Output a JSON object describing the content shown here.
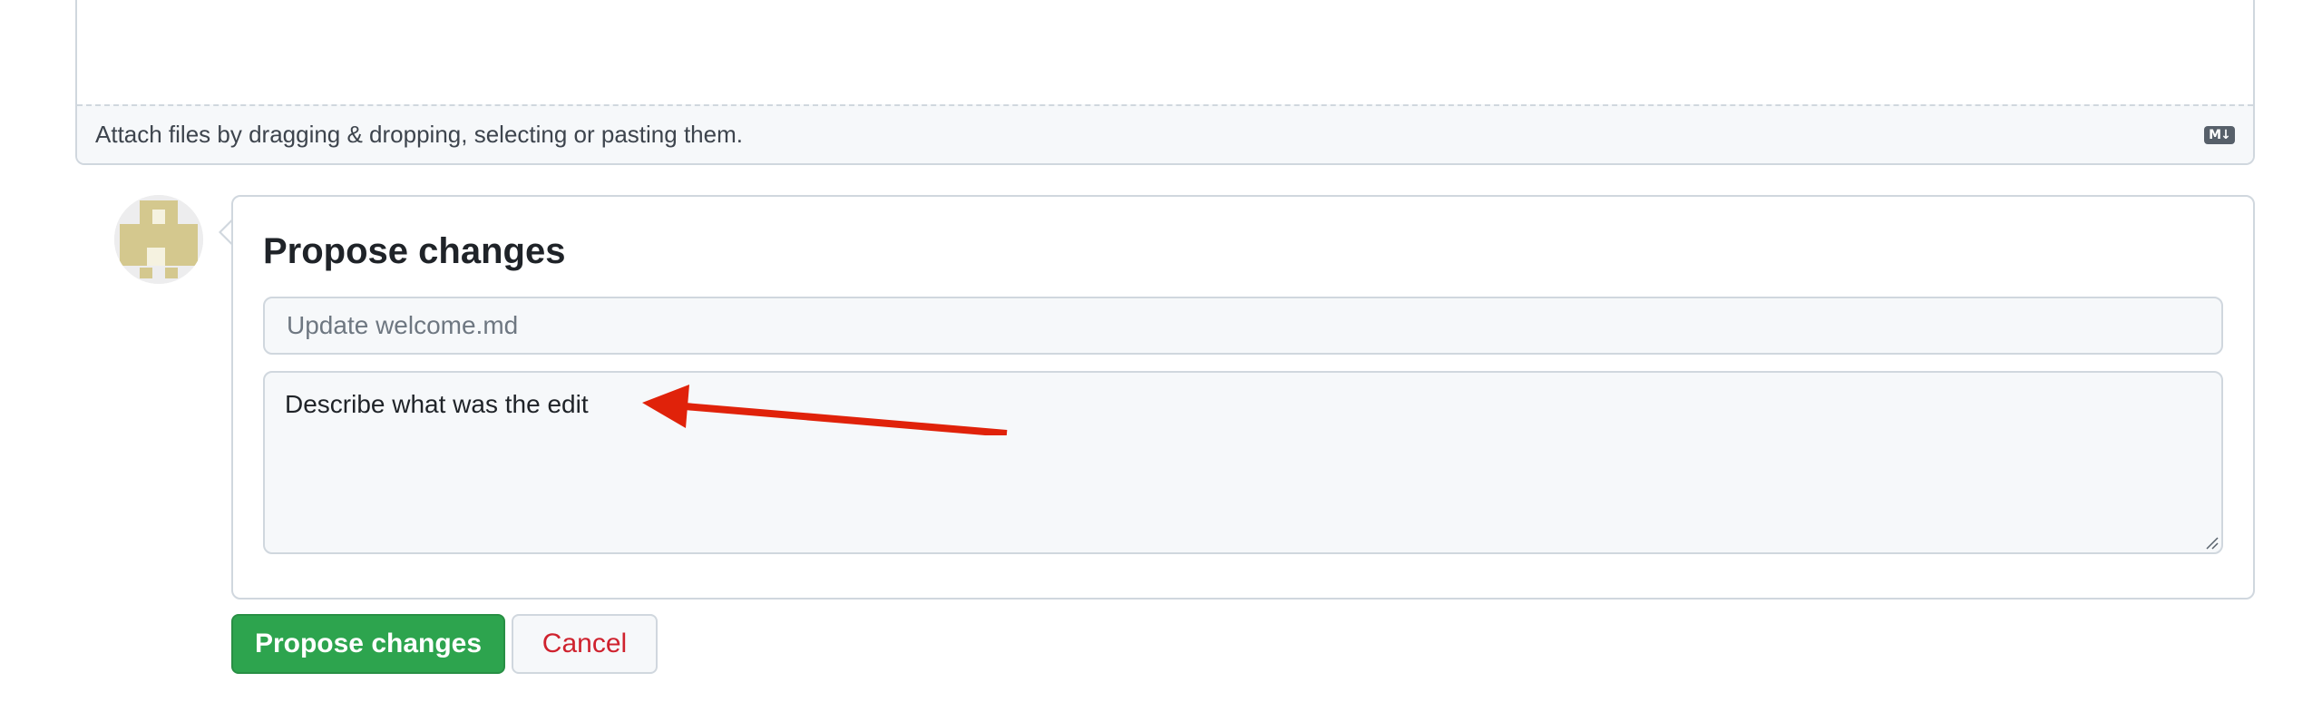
{
  "editor": {
    "attach_hint": "Attach files by dragging & dropping, selecting or pasting them.",
    "markdown_icon": "markdown-icon",
    "markdown_icon_text": "M↓"
  },
  "avatar": {
    "icon": "identicon-avatar",
    "color": "#d4c88e"
  },
  "propose_form": {
    "title": "Propose changes",
    "summary_placeholder": "Update welcome.md",
    "summary_value": "",
    "description_value": "Describe what was the edit"
  },
  "annotation": {
    "icon": "red-arrow-icon",
    "color": "#e0220a"
  },
  "buttons": {
    "submit_label": "Propose changes",
    "cancel_label": "Cancel"
  },
  "colors": {
    "primary_button": "#2da44e",
    "cancel_text": "#cf222e",
    "border": "#d0d7de",
    "field_background": "#f6f8fa"
  }
}
